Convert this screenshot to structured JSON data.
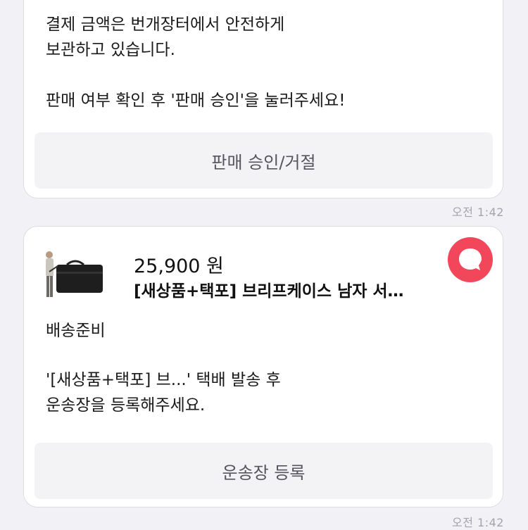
{
  "card1": {
    "message": "결제 금액은 번개장터에서 안전하게\n보관하고 있습니다.\n\n판매 여부 확인 후 '판매 승인'을 눌러주세요!",
    "action_label": "판매 승인/거절",
    "time": "오전 1:42"
  },
  "card2": {
    "product": {
      "price": "25,900 원",
      "title": "[새상품+택포] 브리프케이스 남자 서…",
      "thumbnail_icon": "briefcase-product-photo"
    },
    "status": "배송준비",
    "message": "'[새상품+택포] 브...' 택배 발송 후\n운송장을 등록해주세요.",
    "action_label": "운송장 등록",
    "time": "오전 1:42",
    "badge_icon": "chat-bubble-icon"
  },
  "colors": {
    "accent": "#f2475a",
    "background": "#f1f1f6",
    "card": "#ffffff",
    "button": "#f3f3f5"
  }
}
